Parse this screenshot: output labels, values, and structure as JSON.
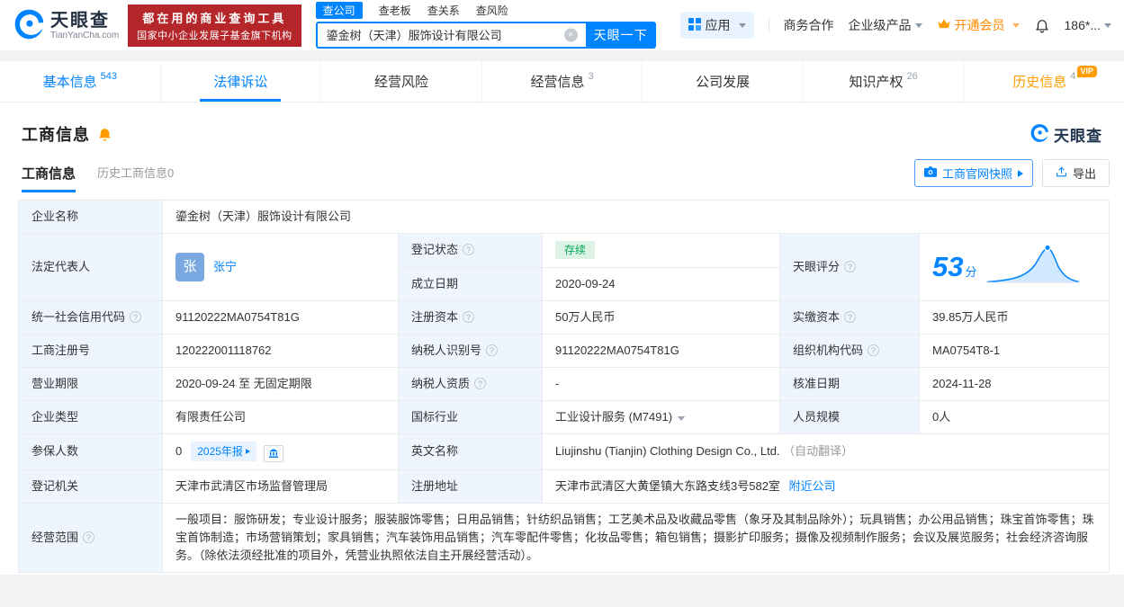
{
  "colors": {
    "accent": "#0084ff",
    "banner_red": "#b5262a",
    "vip_orange": "#ff9d00",
    "status_green": "#00a854",
    "label_bg": "#eef5fe"
  },
  "topbar": {
    "logo": {
      "title": "天眼查",
      "domain": "TianYanCha.com"
    },
    "banner": {
      "line1": "都在用的商业查询工具",
      "line2": "国家中小企业发展子基金旗下机构"
    },
    "search": {
      "tabs": [
        "查公司",
        "查老板",
        "查关系",
        "查风险"
      ],
      "value": "鎏金树（天津）服饰设计有限公司",
      "button": "天眼一下"
    },
    "menu": {
      "apps": "应用",
      "cooperation": "商务合作",
      "enterprise": "企业级产品",
      "vip": "开通会员",
      "account": "186*..."
    }
  },
  "nav": {
    "basic": {
      "label": "基本信息",
      "count": "543"
    },
    "legal": {
      "label": "法律诉讼"
    },
    "risk": {
      "label": "经营风险"
    },
    "operation": {
      "label": "经营信息",
      "count": "3"
    },
    "development": {
      "label": "公司发展"
    },
    "ip": {
      "label": "知识产权",
      "count": "26"
    },
    "history": {
      "label": "历史信息",
      "count": "4",
      "vip": "VIP"
    }
  },
  "section": {
    "title": "工商信息",
    "watermark": "天眼查",
    "subtabs": {
      "current": "工商信息",
      "history": "历史工商信息0"
    },
    "snapshot_button": "工商官网快照",
    "export_button": "导出"
  },
  "fields": {
    "company_name": {
      "label": "企业名称",
      "value": "鎏金树（天津）服饰设计有限公司"
    },
    "legal_rep": {
      "label": "法定代表人",
      "avatar": "张",
      "name": "张宁"
    },
    "reg_status": {
      "label": "登记状态",
      "value": "存续"
    },
    "establish_date": {
      "label": "成立日期",
      "value": "2020-09-24"
    },
    "score": {
      "label": "天眼评分",
      "value": "53",
      "unit": "分"
    },
    "credit_code": {
      "label": "统一社会信用代码",
      "value": "91120222MA0754T81G"
    },
    "reg_capital": {
      "label": "注册资本",
      "value": "50万人民币"
    },
    "paid_capital": {
      "label": "实缴资本",
      "value": "39.85万人民币"
    },
    "reg_number": {
      "label": "工商注册号",
      "value": "120222001118762"
    },
    "taxpayer_id": {
      "label": "纳税人识别号",
      "value": "91120222MA0754T81G"
    },
    "org_code": {
      "label": "组织机构代码",
      "value": "MA0754T8-1"
    },
    "business_term": {
      "label": "营业期限",
      "value": "2020-09-24 至 无固定期限"
    },
    "taxpayer_quality": {
      "label": "纳税人资质",
      "value": "-"
    },
    "approval_date": {
      "label": "核准日期",
      "value": "2024-11-28"
    },
    "company_type": {
      "label": "企业类型",
      "value": "有限责任公司"
    },
    "industry": {
      "label": "国标行业",
      "value": "工业设计服务 (M7491)"
    },
    "staff_size": {
      "label": "人员规模",
      "value": "0人"
    },
    "insured": {
      "label": "参保人数",
      "value": "0",
      "tag": "2025年报"
    },
    "english_name": {
      "label": "英文名称",
      "value": "Liujinshu (Tianjin) Clothing Design Co., Ltd.",
      "note": "（自动翻译）"
    },
    "reg_authority": {
      "label": "登记机关",
      "value": "天津市武清区市场监督管理局"
    },
    "address": {
      "label": "注册地址",
      "value": "天津市武清区大黄堡镇大东路支线3号582室",
      "link": "附近公司"
    },
    "scope": {
      "label": "经营范围",
      "value": "一般项目：服饰研发；专业设计服务；服装服饰零售；日用品销售；针纺织品销售；工艺美术品及收藏品零售（象牙及其制品除外）；玩具销售；办公用品销售；珠宝首饰零售；珠宝首饰制造；市场营销策划；家具销售；汽车装饰用品销售；汽车零配件零售；化妆品零售；箱包销售；摄影扩印服务；摄像及视频制作服务；会议及展览服务；社会经济咨询服务。（除依法须经批准的项目外，凭营业执照依法自主开展经营活动）。"
    }
  }
}
